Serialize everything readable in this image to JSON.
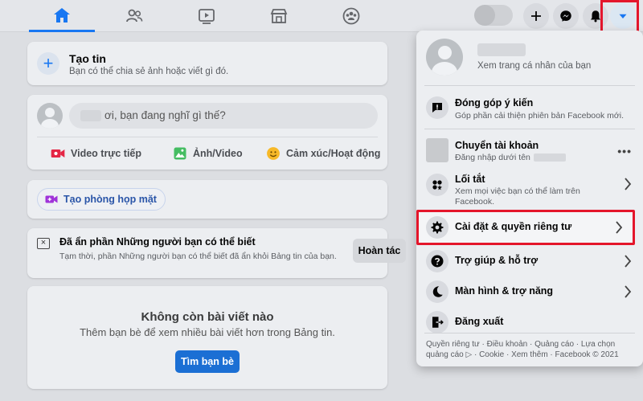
{
  "topbar": {
    "tabs": [
      {
        "name": "home",
        "active": true
      },
      {
        "name": "friends",
        "active": false
      },
      {
        "name": "watch",
        "active": false
      },
      {
        "name": "marketplace",
        "active": false
      },
      {
        "name": "groups",
        "active": false
      }
    ],
    "icons": [
      "home-icon",
      "friends-icon",
      "watch-icon",
      "marketplace-icon",
      "groups-icon",
      "plus-icon",
      "messenger-icon",
      "bell-icon",
      "caret-down-icon"
    ],
    "accent_color": "#1877f2",
    "highlight_color": "#e4162b"
  },
  "create_story": {
    "title": "Tạo tin",
    "subtitle": "Bạn có thể chia sẻ ảnh hoặc viết gì đó.",
    "plus": "+"
  },
  "composer": {
    "placeholder": "ơi, bạn đang nghĩ gì thế?",
    "actions": [
      {
        "label": "Video trực tiếp",
        "icon": "live-video-icon",
        "color": "#e42645"
      },
      {
        "label": "Ảnh/Video",
        "icon": "photo-icon",
        "color": "#45bd62"
      },
      {
        "label": "Cảm xúc/Hoạt động",
        "icon": "feeling-icon",
        "color": "#f7b928"
      }
    ]
  },
  "room": {
    "button_label": "Tạo phòng họp mặt",
    "icon": "video-room-icon"
  },
  "hidden_notice": {
    "title": "Đã ẩn phần Những người bạn có thể biết",
    "body": "Tạm thời, phần Những người bạn có thể biết đã ẩn khỏi Bảng tin của bạn.",
    "undo_label": "Hoàn tác",
    "close_glyph": "×"
  },
  "empty_feed": {
    "title": "Không còn bài viết nào",
    "subtitle": "Thêm bạn bè để xem nhiều bài viết hơn trong Bảng tin.",
    "button_label": "Tìm bạn bè"
  },
  "menu": {
    "profile_sub": "Xem trang cá nhân của bạn",
    "feedback": {
      "label": "Đóng góp ý kiến",
      "sub": "Góp phần cải thiện phiên bản Facebook mới."
    },
    "switch_account": {
      "label": "Chuyển tài khoản",
      "sub": "Đăng nhập dưới tên",
      "more": "•••"
    },
    "shortcuts": {
      "label": "Lối tắt",
      "sub": "Xem mọi việc bạn có thể làm trên Facebook."
    },
    "settings": {
      "label": "Cài đặt & quyền riêng tư"
    },
    "help": {
      "label": "Trợ giúp & hỗ trợ"
    },
    "display": {
      "label": "Màn hình & trợ năng"
    },
    "logout": {
      "label": "Đăng xuất"
    },
    "footer": "Quyền riêng tư · Điều khoản · Quảng cáo · Lựa chọn quảng cáo ▷ · Cookie · Xem thêm · Facebook © 2021"
  }
}
